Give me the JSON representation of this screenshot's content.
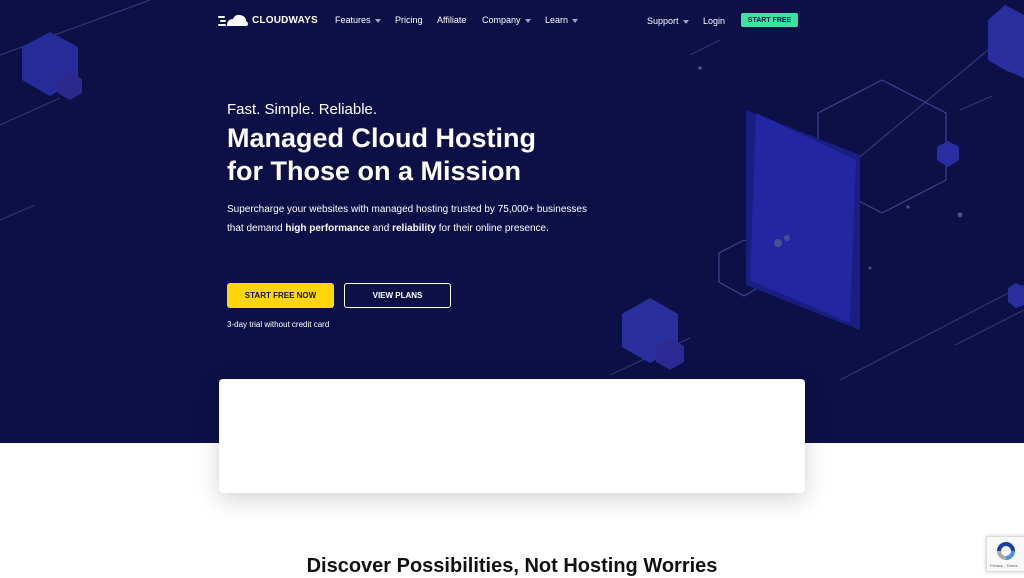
{
  "nav": {
    "logo_text": "CLOUDWAYS",
    "items": [
      {
        "label": "Features",
        "has_dropdown": true
      },
      {
        "label": "Pricing",
        "has_dropdown": false
      },
      {
        "label": "Affiliate",
        "has_dropdown": false
      },
      {
        "label": "Company",
        "has_dropdown": true
      },
      {
        "label": "Learn",
        "has_dropdown": true
      }
    ],
    "support_label": "Support",
    "login_label": "Login",
    "start_free_label": "START FREE"
  },
  "hero": {
    "tagline": "Fast. Simple. Reliable.",
    "headline_line1": "Managed Cloud Hosting",
    "headline_line2": "for Those on a Mission",
    "desc_part1": "Supercharge your websites with managed hosting trusted by 75,000+ businesses that demand ",
    "desc_bold1": "high performance",
    "desc_part2": " and ",
    "desc_bold2": "reliability",
    "desc_part3": " for their online presence.",
    "cta_primary": "START FREE NOW",
    "cta_secondary": "VIEW PLANS",
    "trial_note": "3-day trial without credit card"
  },
  "section": {
    "title": "Discover Possibilities, Not Hosting Worries"
  },
  "recaptcha": {
    "terms": "Privacy - Terms"
  },
  "colors": {
    "hero_bg": "#0c1047",
    "accent_green": "#3ee2a0",
    "accent_yellow": "#ffd60a"
  }
}
